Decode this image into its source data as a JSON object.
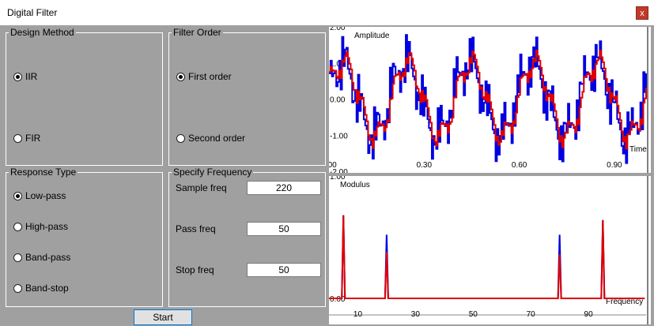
{
  "window": {
    "title": "Digital Filter",
    "close_label": "x"
  },
  "design_method": {
    "title": "Design Method",
    "options": [
      {
        "label": "IIR",
        "checked": true
      },
      {
        "label": "FIR",
        "checked": false
      }
    ]
  },
  "filter_order": {
    "title": "Filter Order",
    "options": [
      {
        "label": "First order",
        "checked": true
      },
      {
        "label": "Second order",
        "checked": false
      }
    ]
  },
  "response_type": {
    "title": "Response Type",
    "options": [
      {
        "label": "Low-pass",
        "checked": true
      },
      {
        "label": "High-pass",
        "checked": false
      },
      {
        "label": "Band-pass",
        "checked": false
      },
      {
        "label": "Band-stop",
        "checked": false
      }
    ]
  },
  "frequency": {
    "title": "Specify Frequency",
    "fields": [
      {
        "label": "Sample freq",
        "value": "220"
      },
      {
        "label": "Pass freq",
        "value": "50"
      },
      {
        "label": "Stop freq",
        "value": "50"
      }
    ]
  },
  "start_label": "Start",
  "chart_data": [
    {
      "type": "line",
      "title": "Amplitude",
      "xlabel": "Time",
      "ylabel": "",
      "xlim": [
        0.0,
        1.0
      ],
      "ylim": [
        -2.0,
        2.0
      ],
      "x_ticks": [
        "0.00",
        "0.30",
        "0.60",
        "0.90"
      ],
      "y_ticks": [
        "2.00",
        "1.00",
        "0.00",
        "-1.00",
        "-2.00"
      ],
      "signal": {
        "components": [
          {
            "freq": 5,
            "amp": 1.0
          },
          {
            "freq": 20,
            "amp": 0.4
          },
          {
            "freq": 80,
            "amp": 0.35
          },
          {
            "freq": 100,
            "amp": 0.3
          }
        ],
        "samples": 220,
        "x_start": 0.0,
        "x_end": 1.0
      },
      "series": [
        {
          "color": "#0000e0",
          "smoothing": 0.0
        },
        {
          "color": "#e00000",
          "smoothing": 0.6
        }
      ]
    },
    {
      "type": "line",
      "title": "Modulus",
      "xlabel": "Frequency",
      "ylabel": "",
      "xlim": [
        0,
        110
      ],
      "ylim": [
        0,
        1
      ],
      "x_ticks": [
        "10",
        "30",
        "50",
        "70",
        "90"
      ],
      "y_ticks": [
        "1.00",
        "0.00"
      ],
      "series": [
        {
          "color": "#0000e0",
          "peaks": [
            [
              5,
              0.68
            ],
            [
              20,
              0.52
            ],
            [
              80,
              0.52
            ],
            [
              95,
              0.64
            ]
          ]
        },
        {
          "color": "#e00000",
          "peaks": [
            [
              5,
              0.68
            ],
            [
              20,
              0.38
            ],
            [
              80,
              0.36
            ],
            [
              95,
              0.64
            ]
          ]
        }
      ]
    }
  ]
}
